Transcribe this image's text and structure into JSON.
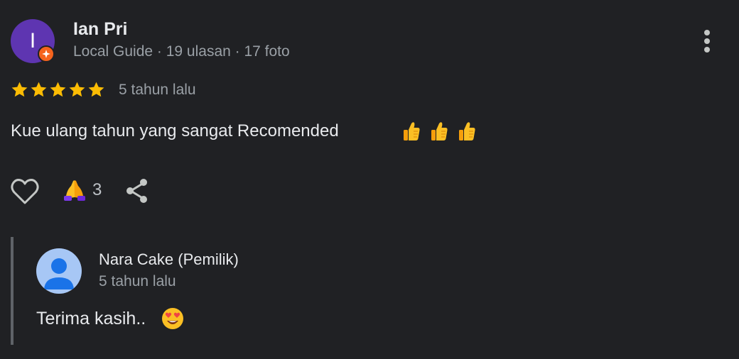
{
  "reviewer": {
    "initial": "I",
    "name": "Ian Pri",
    "meta": "Local Guide · 19 ulasan · 17 foto",
    "badge_icon": "local-guide-star-icon",
    "avatar_color": "#5e35b1"
  },
  "review": {
    "rating": 5,
    "max_rating": 5,
    "date": "5 tahun lalu",
    "text": "Kue ulang tahun yang sangat Recomended",
    "emojis": [
      "thumbs-up",
      "thumbs-up",
      "thumbs-up"
    ]
  },
  "actions": {
    "like_icon": "heart-outline-icon",
    "reaction_icon": "folded-hands-emoji",
    "reaction_count": "3",
    "share_icon": "share-icon"
  },
  "reply": {
    "owner_name": "Nara Cake (Pemilik)",
    "date": "5 tahun lalu",
    "text": "Terima kasih..",
    "emoji": "smiling-face-with-heart-eyes"
  },
  "colors": {
    "background": "#202124",
    "star": "#fbbc04",
    "text_primary": "#e8eaed",
    "text_secondary": "#9aa0a6",
    "badge": "#f5631d",
    "reply_bar": "#5f6368"
  }
}
